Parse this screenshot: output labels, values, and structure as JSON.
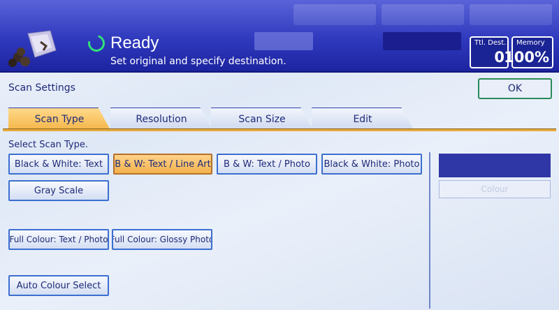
{
  "header": {
    "top_tabs": [
      "",
      "",
      ""
    ],
    "status_title": "Ready",
    "status_message": "Set original and specify destination.",
    "total_destinations_label": "Ttl. Dest.",
    "total_destinations_value": "0",
    "memory_label": "Memory",
    "memory_value": "100%"
  },
  "panel": {
    "title": "Scan Settings",
    "ok_label": "OK",
    "tabs": [
      {
        "label": "Scan Type",
        "active": true
      },
      {
        "label": "Resolution",
        "active": false
      },
      {
        "label": "Scan Size",
        "active": false
      },
      {
        "label": "Edit",
        "active": false
      }
    ],
    "section_label": "Select Scan Type.",
    "options": [
      {
        "label": "Black & White: Text",
        "selected": false
      },
      {
        "label": "B & W: Text / Line Art",
        "selected": true
      },
      {
        "label": "B & W: Text / Photo",
        "selected": false
      },
      {
        "label": "Black & White: Photo",
        "selected": false
      },
      {
        "label": "Gray Scale",
        "selected": false
      },
      {
        "label": "Full Colour: Text / Photo",
        "selected": false
      },
      {
        "label": "Full Colour: Glossy Photo",
        "selected": false
      },
      {
        "label": "Auto Colour Select",
        "selected": false
      }
    ],
    "side_button_label": "Colour"
  },
  "colors": {
    "header_blue": "#2f39bd",
    "selected_orange": "#f3b24d",
    "button_border": "#3b6fd0",
    "ready_green": "#33e07a"
  }
}
